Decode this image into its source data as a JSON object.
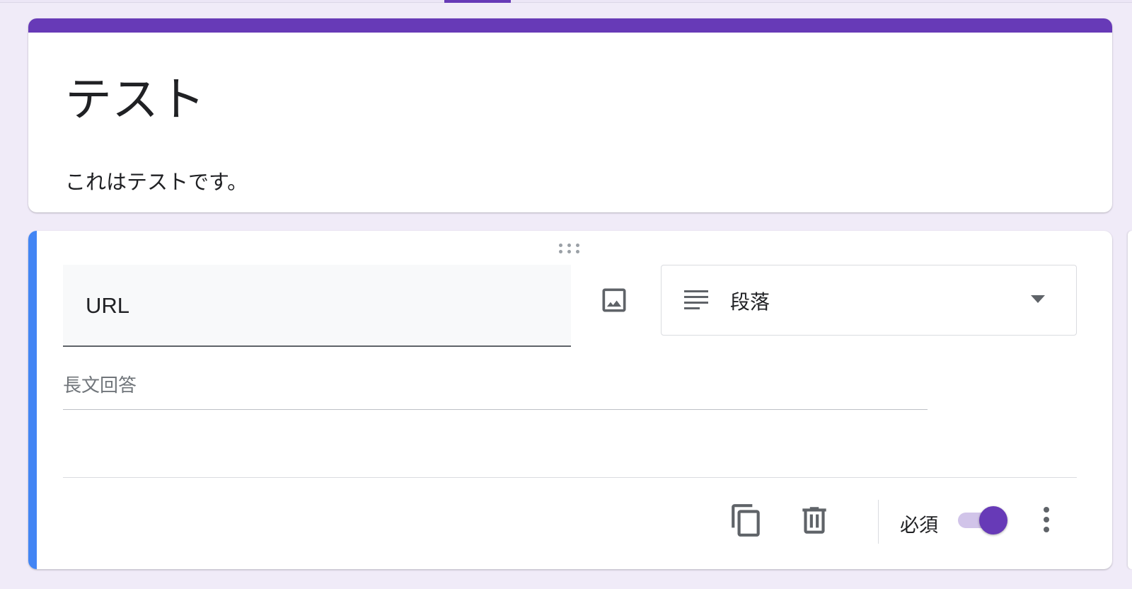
{
  "form": {
    "title": "テスト",
    "description": "これはテストです。"
  },
  "question": {
    "title_value": "URL",
    "type_label": "段落",
    "answer_placeholder": "長文回答",
    "required_label": "必須",
    "required": true
  },
  "icons": {
    "drag": "drag-handle-icon",
    "image": "image-icon",
    "paragraph": "paragraph-lines-icon",
    "dropdown": "dropdown-arrow-icon",
    "copy": "copy-icon",
    "delete": "trash-icon",
    "more": "more-vertical-icon"
  },
  "colors": {
    "theme": "#673ab7",
    "background": "#f0ebf8",
    "focus_bar": "#4285f4",
    "toggle_track": "#d1c4e9"
  }
}
